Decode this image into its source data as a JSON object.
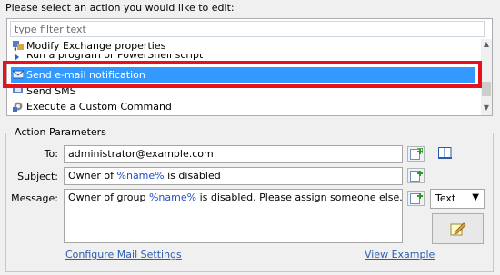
{
  "prompt": "Please select an action you would like to edit:",
  "filter": {
    "placeholder": "type filter text"
  },
  "actions": [
    {
      "label": "Modify Exchange properties",
      "icon": "exchange-mailbox-icon"
    },
    {
      "label": "Run a program or PowerShell script",
      "icon": "script-arrow-icon"
    },
    {
      "label": "Send e-mail notification",
      "icon": "email-notification-icon",
      "selected": true
    },
    {
      "label": "Send SMS",
      "icon": "sms-icon"
    },
    {
      "label": "Execute a Custom Command",
      "icon": "custom-command-gear-icon"
    }
  ],
  "parameters": {
    "group_title": "Action Parameters",
    "to_label": "To:",
    "to_value": "administrator@example.com",
    "subject_label": "Subject:",
    "subject_prefix": "Owner of ",
    "subject_var": "%name%",
    "subject_suffix": " is disabled",
    "message_label": "Message:",
    "message_prefix": "Owner of group ",
    "message_var": "%name%",
    "message_suffix": " is disabled. Please assign someone else.",
    "format_selected": "Text",
    "configure_link": "Configure Mail Settings",
    "view_example_link": "View Example"
  },
  "colors": {
    "selection": "#3399ff",
    "highlight_frame": "#e8111b",
    "variable": "#1e4fc3",
    "link": "#2a5db0"
  }
}
